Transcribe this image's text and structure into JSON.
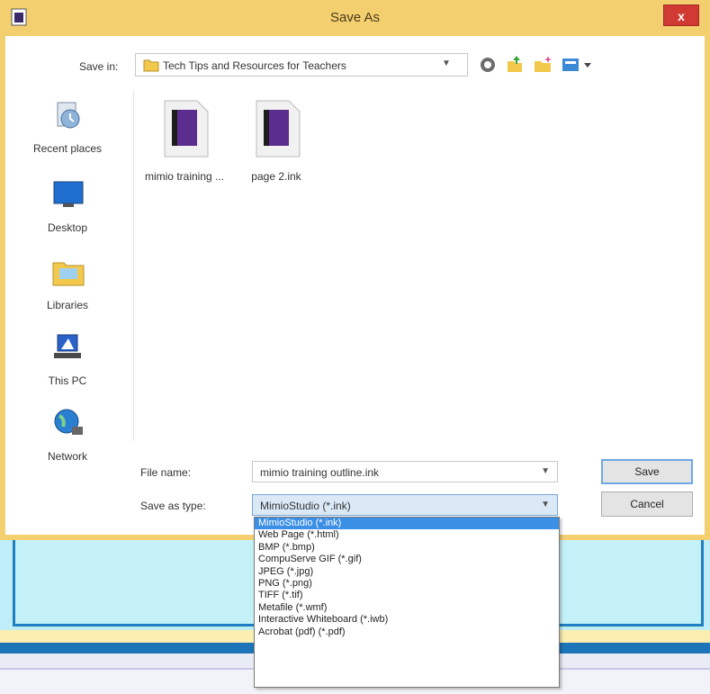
{
  "window": {
    "title": "Save As",
    "close_label": "x"
  },
  "save_in": {
    "label": "Save in:",
    "value": "Tech Tips and Resources for Teachers"
  },
  "places": [
    {
      "label": "Recent places",
      "icon": "recent-places-icon"
    },
    {
      "label": "Desktop",
      "icon": "desktop-icon"
    },
    {
      "label": "Libraries",
      "icon": "libraries-icon"
    },
    {
      "label": "This PC",
      "icon": "this-pc-icon"
    },
    {
      "label": "Network",
      "icon": "network-icon"
    }
  ],
  "files": [
    {
      "name": "mimio training ...",
      "icon": "mimio-document-icon"
    },
    {
      "name": "page 2.ink",
      "icon": "mimio-document-icon"
    }
  ],
  "file_name": {
    "label": "File name:",
    "value": "mimio training outline.ink"
  },
  "save_as_type": {
    "label": "Save as type:",
    "value": "MimioStudio (*.ink)",
    "options": [
      "MimioStudio (*.ink)",
      "Web Page (*.html)",
      "BMP (*.bmp)",
      "CompuServe GIF (*.gif)",
      "JPEG (*.jpg)",
      "PNG (*.png)",
      "TIFF (*.tif)",
      "Metafile (*.wmf)",
      "Interactive Whiteboard (*.iwb)",
      "Acrobat (pdf) (*.pdf)"
    ],
    "selected_index": 0
  },
  "buttons": {
    "save": "Save",
    "cancel": "Cancel"
  },
  "colors": {
    "frame": "#f3cf70",
    "close": "#d13a32",
    "selection": "#3b8fe4"
  }
}
